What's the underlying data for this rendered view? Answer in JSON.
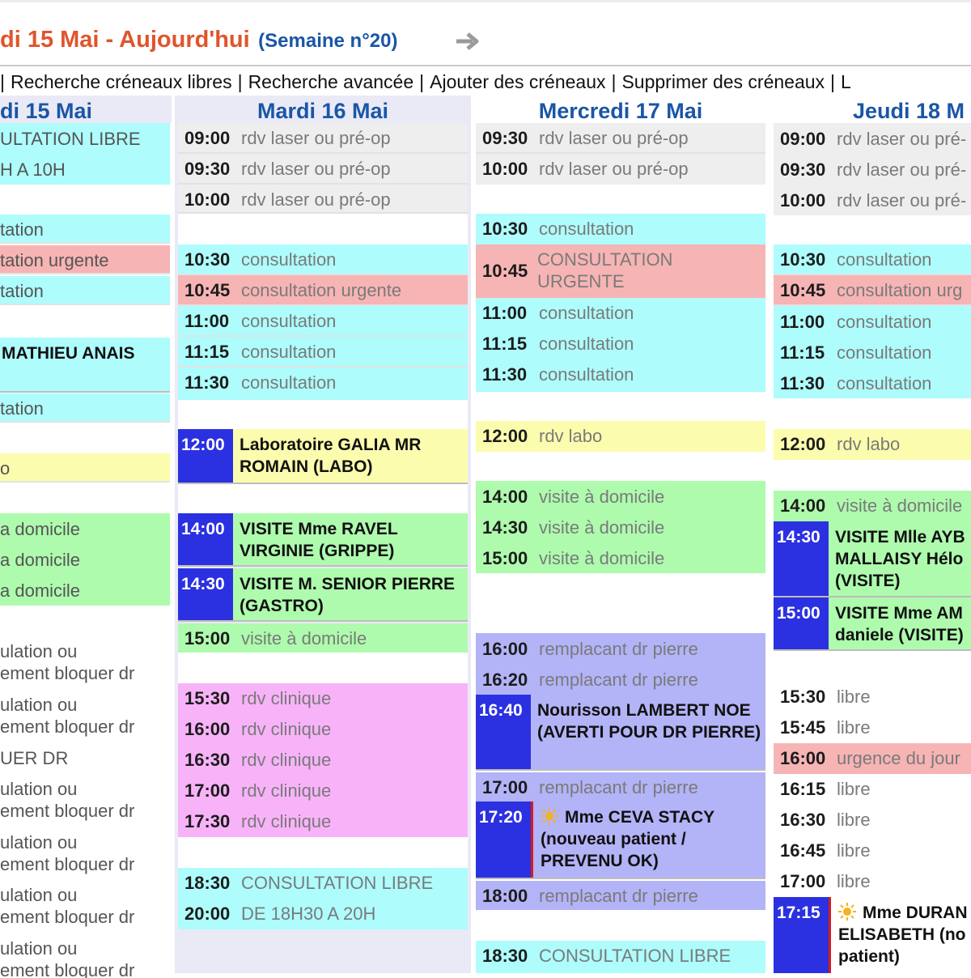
{
  "header": {
    "date": "di 15 Mai - Aujourd'hui",
    "week": "(Semaine n°20)"
  },
  "menu": {
    "lead_sep": "|",
    "items": [
      "Recherche créneaux libres",
      "Recherche avancée",
      "Ajouter des créneaux",
      "Supprimer des créneaux",
      "L"
    ],
    "sep": "|"
  },
  "days": [
    {
      "header": "di 15 Mai",
      "fragments": [
        "ULTATION LIBRE",
        "H A 10H",
        "tation",
        "tation urgente",
        "tation",
        "MATHIEU ANAIS",
        "tation",
        "o",
        "a domicile",
        "a domicile",
        "a domicile",
        "ulation ou",
        "ement bloquer dr",
        "ulation ou",
        "ement bloquer dr",
        "UER DR",
        "ulation ou",
        "ement bloquer dr",
        "ulation ou",
        "ement bloquer dr",
        "ulation ou",
        "ement bloquer dr",
        "ulation ou",
        "ement bloquer dr"
      ]
    },
    {
      "header": "Mardi 16 Mai",
      "slots": [
        {
          "time": "09:00",
          "label": "rdv laser ou pré-op"
        },
        {
          "time": "09:30",
          "label": "rdv laser ou pré-op"
        },
        {
          "time": "10:00",
          "label": "rdv laser ou pré-op"
        },
        {
          "time": "10:30",
          "label": "consultation"
        },
        {
          "time": "10:45",
          "label": "consultation urgente"
        },
        {
          "time": "11:00",
          "label": "consultation"
        },
        {
          "time": "11:15",
          "label": "consultation"
        },
        {
          "time": "11:30",
          "label": "consultation"
        },
        {
          "time": "12:00",
          "label": "Laboratoire GALIA MR ROMAIN (LABO)"
        },
        {
          "time": "14:00",
          "label": "VISITE Mme RAVEL VIRGINIE (GRIPPE)"
        },
        {
          "time": "14:30",
          "label": "VISITE M. SENIOR PIERRE (GASTRO)"
        },
        {
          "time": "15:00",
          "label": "visite à domicile"
        },
        {
          "time": "15:30",
          "label": "rdv clinique"
        },
        {
          "time": "16:00",
          "label": "rdv clinique"
        },
        {
          "time": "16:30",
          "label": "rdv clinique"
        },
        {
          "time": "17:00",
          "label": "rdv clinique"
        },
        {
          "time": "17:30",
          "label": "rdv clinique"
        },
        {
          "time": "18:30",
          "label": "CONSULTATION LIBRE"
        },
        {
          "time": "20:00",
          "label": "DE 18H30 A 20H"
        }
      ]
    },
    {
      "header": "Mercredi 17 Mai",
      "slots": [
        {
          "time": "09:30",
          "label": "rdv laser ou pré-op"
        },
        {
          "time": "10:00",
          "label": "rdv laser ou pré-op"
        },
        {
          "time": "10:30",
          "label": "consultation"
        },
        {
          "time": "10:45",
          "label": "CONSULTATION URGENTE"
        },
        {
          "time": "11:00",
          "label": "consultation"
        },
        {
          "time": "11:15",
          "label": "consultation"
        },
        {
          "time": "11:30",
          "label": "consultation"
        },
        {
          "time": "12:00",
          "label": "rdv labo"
        },
        {
          "time": "14:00",
          "label": "visite à domicile"
        },
        {
          "time": "14:30",
          "label": "visite à domicile"
        },
        {
          "time": "15:00",
          "label": "visite à domicile"
        },
        {
          "time": "16:00",
          "label": "remplacant dr pierre"
        },
        {
          "time": "16:20",
          "label": "remplacant dr pierre"
        },
        {
          "time": "16:40",
          "label": "Nourisson LAMBERT NOE (AVERTI POUR DR PIERRE)"
        },
        {
          "time": "17:00",
          "label": "remplacant dr pierre"
        },
        {
          "time": "17:20",
          "label": "Mme CEVA STACY (nouveau patient / PREVENU OK)"
        },
        {
          "time": "18:00",
          "label": "remplacant dr pierre"
        },
        {
          "time": "18:30",
          "label": "CONSULTATION LIBRE"
        }
      ]
    },
    {
      "header": "Jeudi 18 M",
      "slots": [
        {
          "time": "09:00",
          "label": "rdv laser ou pré-"
        },
        {
          "time": "09:30",
          "label": "rdv laser ou pré-"
        },
        {
          "time": "10:00",
          "label": "rdv laser ou pré-"
        },
        {
          "time": "10:30",
          "label": "consultation"
        },
        {
          "time": "10:45",
          "label": "consultation urg"
        },
        {
          "time": "11:00",
          "label": "consultation"
        },
        {
          "time": "11:15",
          "label": "consultation"
        },
        {
          "time": "11:30",
          "label": "consultation"
        },
        {
          "time": "12:00",
          "label": "rdv labo"
        },
        {
          "time": "14:00",
          "label": "visite à domicile"
        },
        {
          "time": "14:30",
          "label": "VISITE Mlle AYB MALLAISY Hélo (VISITE)"
        },
        {
          "time": "15:00",
          "label": "VISITE Mme AM daniele (VISITE)"
        },
        {
          "time": "15:30",
          "label": "libre"
        },
        {
          "time": "15:45",
          "label": "libre"
        },
        {
          "time": "16:00",
          "label": "urgence du jour"
        },
        {
          "time": "16:15",
          "label": "libre"
        },
        {
          "time": "16:30",
          "label": "libre"
        },
        {
          "time": "16:45",
          "label": "libre"
        },
        {
          "time": "17:00",
          "label": "libre"
        },
        {
          "time": "17:15",
          "label": "Mme DURAN ELISABETH (no patient)"
        }
      ]
    }
  ],
  "colors": {
    "consultation": "#aefcfc",
    "laser": "#eeeeee",
    "urgent": "#f7b4b4",
    "visite": "#aefbae",
    "labo": "#fcfcae",
    "remplacant": "#b3b3f8",
    "clinique": "#f8b3f8",
    "booked_time": "#2b31e0"
  }
}
